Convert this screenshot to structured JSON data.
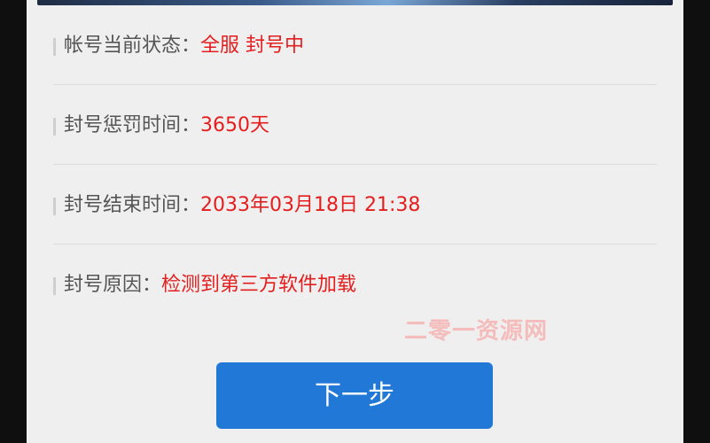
{
  "status": {
    "label": "帐号当前状态：",
    "value": "全服 封号中"
  },
  "penalty": {
    "label": "封号惩罚时间：",
    "value": "3650天"
  },
  "end_time": {
    "label": "封号结束时间：",
    "value": "2033年03月18日 21:38"
  },
  "reason": {
    "label": "封号原因：",
    "value": "检测到第三方软件加载"
  },
  "watermark": "二零一资源网",
  "next_button_label": "下一步",
  "colors": {
    "value_red": "#e41e1e",
    "button_blue": "#2178d6",
    "panel_bg": "#efefef"
  }
}
